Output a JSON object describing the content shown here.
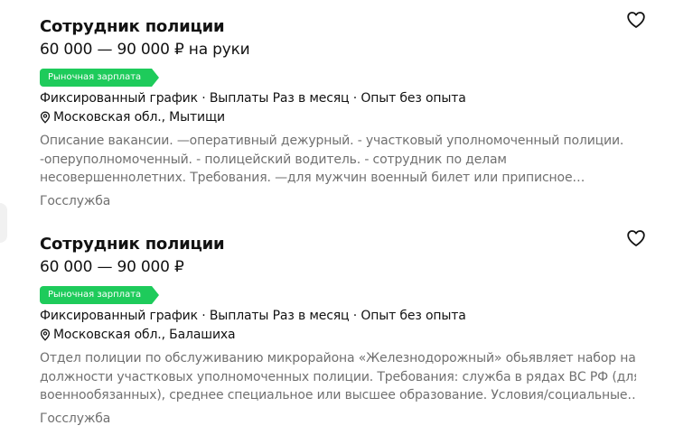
{
  "vacancies": [
    {
      "title": "Сотрудник полиции",
      "salary": "60 000 — 90 000 ₽ на руки",
      "badge": "Рыночная зарплата",
      "meta": "Фиксированный график · Выплаты Раз в месяц · Опыт без опыта",
      "location": "Московская обл., Мытищи",
      "description": [
        "Описание вакансии. —оперативный дежурный. - участковый уполномоченный полиции.",
        "-оперуполномоченный. - полицейский водитель. - сотрудник по делам",
        "несовершеннолетних. Требования. —для мужчин военный билет или приписное…"
      ],
      "employer": "Госслужба",
      "favorite_icon": "heart-outline-icon"
    },
    {
      "title": "Сотрудник полиции",
      "salary": "60 000 — 90 000 ₽",
      "badge": "Рыночная зарплата",
      "meta": "Фиксированный график · Выплаты Раз в месяц · Опыт без опыта",
      "location": "Московская обл., Балашиха",
      "description": [
        "Отдел полиции по обслуживанию микрорайона «Железнодорожный» обьявляет набор на",
        "должности участковых уполномоченных полиции. Требования: служба в рядах ВС РФ (для",
        "военнообязанных), среднее специальное или высшее образование. Условия/социальные…"
      ],
      "employer": "Госслужба",
      "favorite_icon": "heart-outline-icon"
    }
  ],
  "colors": {
    "badge_green": "#1ecb5b",
    "text_primary": "#121212",
    "text_secondary": "#707070"
  }
}
